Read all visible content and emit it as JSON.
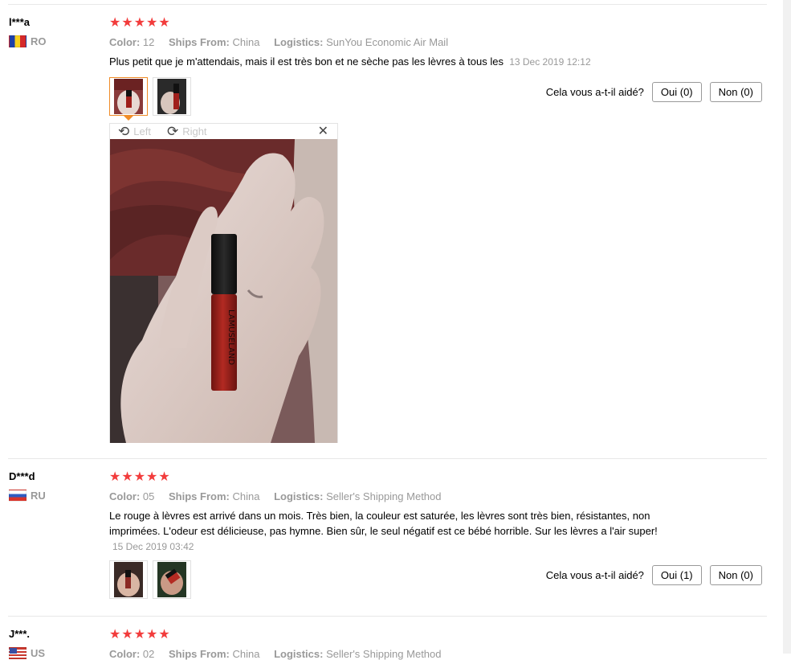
{
  "reviews": [
    {
      "user": "l***a",
      "country": "RO",
      "stars": "★★★★★",
      "color_label": "Color:",
      "color_value": "12",
      "ships_label": "Ships From:",
      "ships_value": "China",
      "logistics_label": "Logistics:",
      "logistics_value": "SunYou Economic Air Mail",
      "text": "Plus petit que je m'attendais, mais il est très bon et ne sèche pas les lèvres à tous les",
      "date": "13 Dec 2019 12:12",
      "helpful_label": "Cela vous a-t-il aidé?",
      "yes_label": "Oui (0)",
      "no_label": "Non (0)"
    },
    {
      "user": "D***d",
      "country": "RU",
      "stars": "★★★★★",
      "color_label": "Color:",
      "color_value": "05",
      "ships_label": "Ships From:",
      "ships_value": "China",
      "logistics_label": "Logistics:",
      "logistics_value": "Seller's Shipping Method",
      "text": "Le rouge à lèvres est arrivé dans un mois. Très bien, la couleur est saturée, les lèvres sont très bien, résistantes, non imprimées. L'odeur est délicieuse, pas hymne. Bien sûr, le seul négatif est ce bébé horrible. Sur les lèvres a l'air super!",
      "date": "15 Dec 2019 03:42",
      "helpful_label": "Cela vous a-t-il aidé?",
      "yes_label": "Oui (1)",
      "no_label": "Non (0)"
    },
    {
      "user": "J***.",
      "country": "US",
      "stars": "★★★★★",
      "color_label": "Color:",
      "color_value": "02",
      "ships_label": "Ships From:",
      "ships_value": "China",
      "logistics_label": "Logistics:",
      "logistics_value": "Seller's Shipping Method"
    }
  ],
  "viewer": {
    "left_label": "Left",
    "right_label": "Right",
    "rotate_left_icon": "rotate-left-icon",
    "rotate_right_icon": "rotate-right-icon",
    "close_icon": "close-icon",
    "lipstick_print": "LAMUSELAND"
  },
  "colors": {
    "star": "#f23c3c",
    "active_thumb": "#f08c28",
    "muted": "#999999"
  }
}
